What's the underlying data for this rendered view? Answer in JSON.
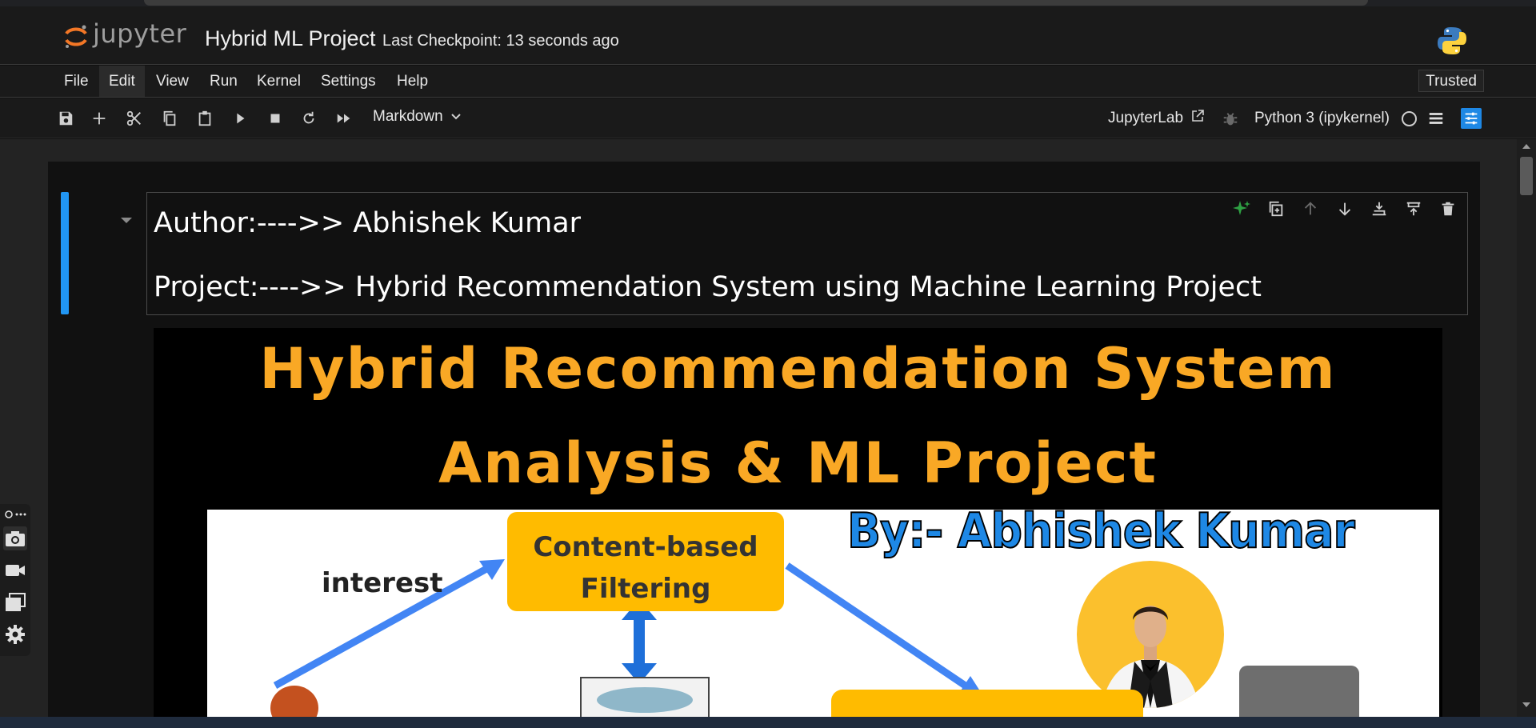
{
  "header": {
    "logo_text": "jupyter",
    "notebook_title": "Hybrid ML Project",
    "checkpoint": "Last Checkpoint: 13 seconds ago",
    "kernel_logo": "python-logo-icon"
  },
  "menu": {
    "items": [
      "File",
      "Edit",
      "View",
      "Run",
      "Kernel",
      "Settings",
      "Help"
    ],
    "active": "Edit",
    "trusted": "Trusted"
  },
  "toolbar": {
    "icons": [
      "save-icon",
      "add-cell-icon",
      "cut-icon",
      "copy-icon",
      "paste-icon",
      "run-icon",
      "stop-icon",
      "restart-icon",
      "run-all-icon"
    ],
    "cell_type": "Markdown",
    "jupyterlab_link": "JupyterLab",
    "kernel_name": "Python 3 (ipykernel)"
  },
  "cell": {
    "author_line": "Author:---->> Abhishek Kumar",
    "project_line": "Project:---->> Hybrid Recommendation System using Machine Learning Project",
    "tools": [
      "sparkle-icon",
      "duplicate-icon",
      "move-up-icon",
      "move-down-icon",
      "insert-above-icon",
      "insert-below-icon",
      "delete-icon"
    ]
  },
  "banner": {
    "title_line1": "Hybrid Recommendation System",
    "title_line2": "Analysis & ML Project",
    "byline": "By:- Abhishek Kumar",
    "content_box": "Content-based Filtering",
    "interest_label": "interest",
    "colors": {
      "title": "#f9a825",
      "byline": "#1e88e5",
      "box": "#ffbb00"
    }
  }
}
